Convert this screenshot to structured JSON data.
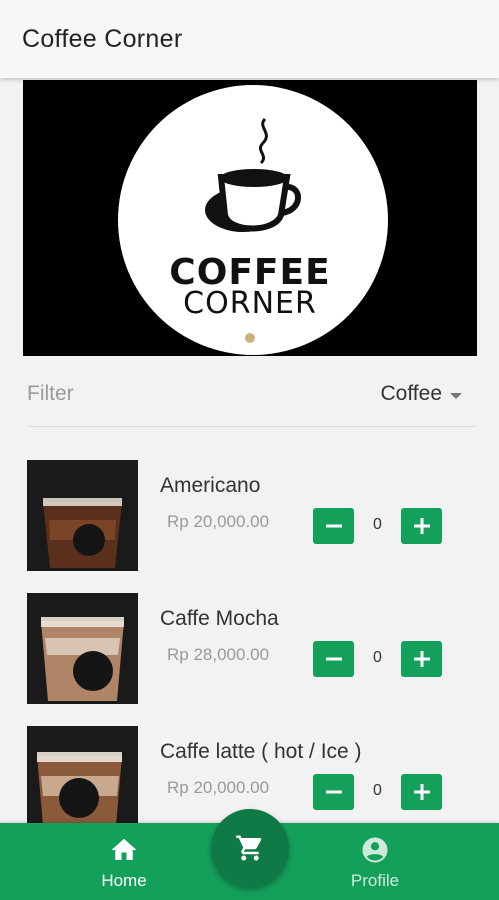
{
  "app": {
    "title": "Coffee Corner"
  },
  "banner": {
    "logo_line1": "COFFEE",
    "logo_line2": "CORNER"
  },
  "filter": {
    "label": "Filter",
    "selected": "Coffee"
  },
  "products": [
    {
      "name": "Americano",
      "price": "Rp 20,000.00",
      "qty": "0"
    },
    {
      "name": "Caffe Mocha",
      "price": "Rp 28,000.00",
      "qty": "0"
    },
    {
      "name": "Caffe latte ( hot / Ice )",
      "price": "Rp 20,000.00",
      "qty": "0"
    }
  ],
  "nav": {
    "home": "Home",
    "profile": "Profile"
  },
  "icons": {
    "home": "home-icon",
    "cart": "cart-icon",
    "profile": "account-circle-icon",
    "minus": "minus-icon",
    "plus": "plus-icon",
    "dropdown": "chevron-down-icon"
  },
  "colors": {
    "accent": "#13a05b",
    "fab": "#0f7a46",
    "banner_bg": "#000000"
  }
}
